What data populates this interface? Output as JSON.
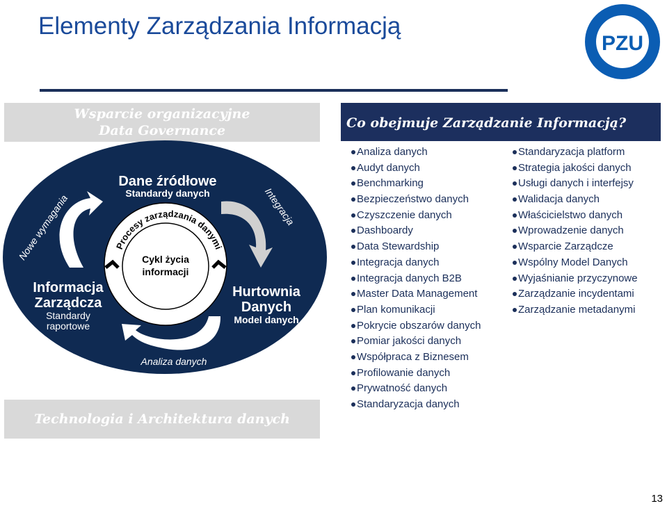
{
  "title": "Elementy Zarządzania Informacją",
  "logo": {
    "text": "PZU",
    "color": "#0b5db3"
  },
  "top_box": {
    "line1": "Wsparcie organizacyjne",
    "line2": "Data Governance"
  },
  "bottom_box": "Technologia i Architektura danych",
  "diagram": {
    "ellipse_color": "#0f2a52",
    "source": {
      "title": "Dane źródłowe",
      "sub": "Standardy danych"
    },
    "warehouse": {
      "title1": "Hurtownia",
      "title2": "Danych",
      "sub": "Model danych"
    },
    "mgmt_info": {
      "title1": "Informacja",
      "title2": "Zarządcza",
      "sub1": "Standardy",
      "sub2": "raportowe"
    },
    "arrow_labels": {
      "new_requirements": "Nowe wymagania",
      "integration": "Integracja",
      "analysis": "Analiza danych"
    },
    "ring_text": "Procesy zarządzania danymi",
    "center": {
      "line1": "Cykl życia",
      "line2": "informacji"
    }
  },
  "right_panel": {
    "heading": "Co obejmuje Zarządzanie Informacją?",
    "col1": [
      "Analiza danych",
      "Audyt danych",
      "Benchmarking",
      "Bezpieczeństwo danych",
      "Czyszczenie danych",
      "Dashboardy",
      "Data Stewardship",
      "Integracja danych",
      "Integracja danych B2B",
      "Master Data Management",
      "Plan komunikacji",
      "Pokrycie obszarów danych",
      "Pomiar jakości danych",
      "Współpraca z Biznesem",
      "Profilowanie danych",
      "Prywatność danych",
      "Standaryzacja danych"
    ],
    "col2": [
      "Standaryzacja platform",
      "Strategia jakości danych",
      "Usługi danych i interfejsy",
      "Walidacja danych",
      "Właścicielstwo danych",
      "Wprowadzenie danych",
      "Wsparcie Zarządcze",
      "Wspólny Model Danych",
      "Wyjaśnianie przyczynowe",
      "Zarządzanie incydentami",
      "Zarządzanie metadanymi"
    ]
  },
  "page_number": "13"
}
